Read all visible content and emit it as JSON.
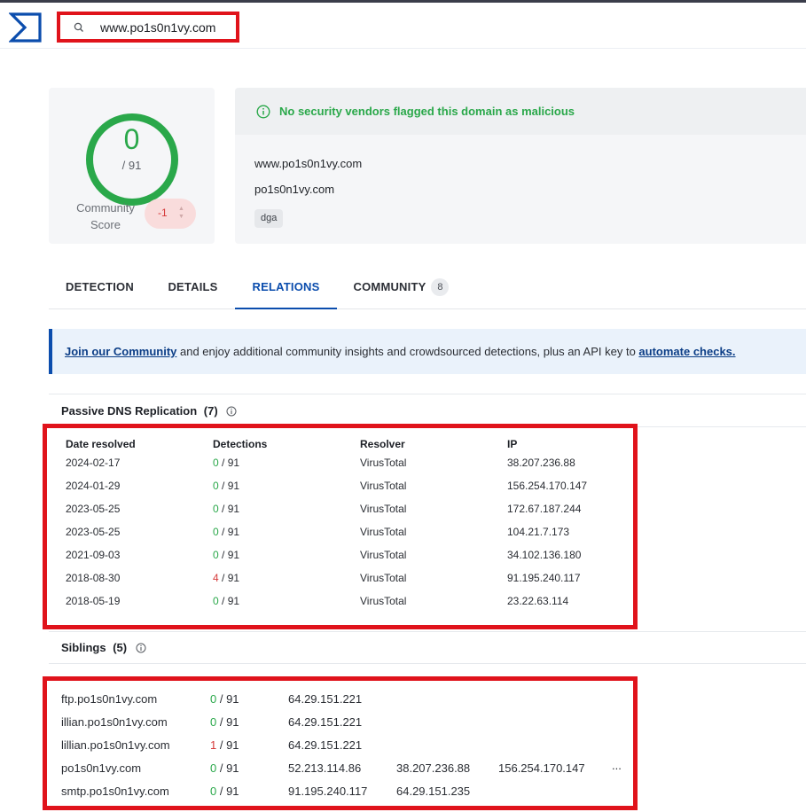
{
  "search": {
    "value": "www.po1s0n1vy.com"
  },
  "score": {
    "value": "0",
    "denominator": "/ 91",
    "community_label_line1": "Community",
    "community_label_line2": "Score",
    "community_value": "-1"
  },
  "summary": {
    "banner": "No security vendors flagged this domain as malicious",
    "domain": "www.po1s0n1vy.com",
    "parent_domain": "po1s0n1vy.com",
    "tag": "dga"
  },
  "tabs": [
    {
      "label": "DETECTION"
    },
    {
      "label": "DETAILS"
    },
    {
      "label": "RELATIONS",
      "active": true
    },
    {
      "label": "COMMUNITY",
      "badge": "8"
    }
  ],
  "notice": {
    "link1": "Join our Community",
    "middle": " and enjoy additional community insights and crowdsourced detections, plus an API key to ",
    "link2": "automate checks."
  },
  "passive_dns": {
    "title": "Passive DNS Replication",
    "count": "(7)",
    "columns": [
      "Date resolved",
      "Detections",
      "Resolver",
      "IP"
    ],
    "rows": [
      {
        "date": "2024-02-17",
        "det": "0",
        "total": " / 91",
        "resolver": "VirusTotal",
        "ip": "38.207.236.88"
      },
      {
        "date": "2024-01-29",
        "det": "0",
        "total": " / 91",
        "resolver": "VirusTotal",
        "ip": "156.254.170.147"
      },
      {
        "date": "2023-05-25",
        "det": "0",
        "total": " / 91",
        "resolver": "VirusTotal",
        "ip": "172.67.187.244"
      },
      {
        "date": "2023-05-25",
        "det": "0",
        "total": " / 91",
        "resolver": "VirusTotal",
        "ip": "104.21.7.173"
      },
      {
        "date": "2021-09-03",
        "det": "0",
        "total": " / 91",
        "resolver": "VirusTotal",
        "ip": "34.102.136.180"
      },
      {
        "date": "2018-08-30",
        "det": "4",
        "total": " / 91",
        "resolver": "VirusTotal",
        "ip": "91.195.240.117"
      },
      {
        "date": "2018-05-19",
        "det": "0",
        "total": " / 91",
        "resolver": "VirusTotal",
        "ip": "23.22.63.114"
      }
    ]
  },
  "siblings": {
    "title": "Siblings",
    "count": "(5)",
    "rows": [
      {
        "domain": "ftp.po1s0n1vy.com",
        "det": "0",
        "total": " / 91",
        "ip1": "64.29.151.221",
        "ip2": "",
        "ip3": "",
        "more": ""
      },
      {
        "domain": "illian.po1s0n1vy.com",
        "det": "0",
        "total": " / 91",
        "ip1": "64.29.151.221",
        "ip2": "",
        "ip3": "",
        "more": ""
      },
      {
        "domain": "lillian.po1s0n1vy.com",
        "det": "1",
        "total": " / 91",
        "ip1": "64.29.151.221",
        "ip2": "",
        "ip3": "",
        "more": ""
      },
      {
        "domain": "po1s0n1vy.com",
        "det": "0",
        "total": " / 91",
        "ip1": "52.213.114.86",
        "ip2": "38.207.236.88",
        "ip3": "156.254.170.147",
        "more": "..."
      },
      {
        "domain": "smtp.po1s0n1vy.com",
        "det": "0",
        "total": " / 91",
        "ip1": "91.195.240.117",
        "ip2": "64.29.151.235",
        "ip3": "",
        "more": ""
      }
    ]
  },
  "colors": {
    "accent": "#0b4dad",
    "clean": "#2aa84a",
    "malicious": "#d53a3a",
    "highlight": "#e0131b"
  }
}
